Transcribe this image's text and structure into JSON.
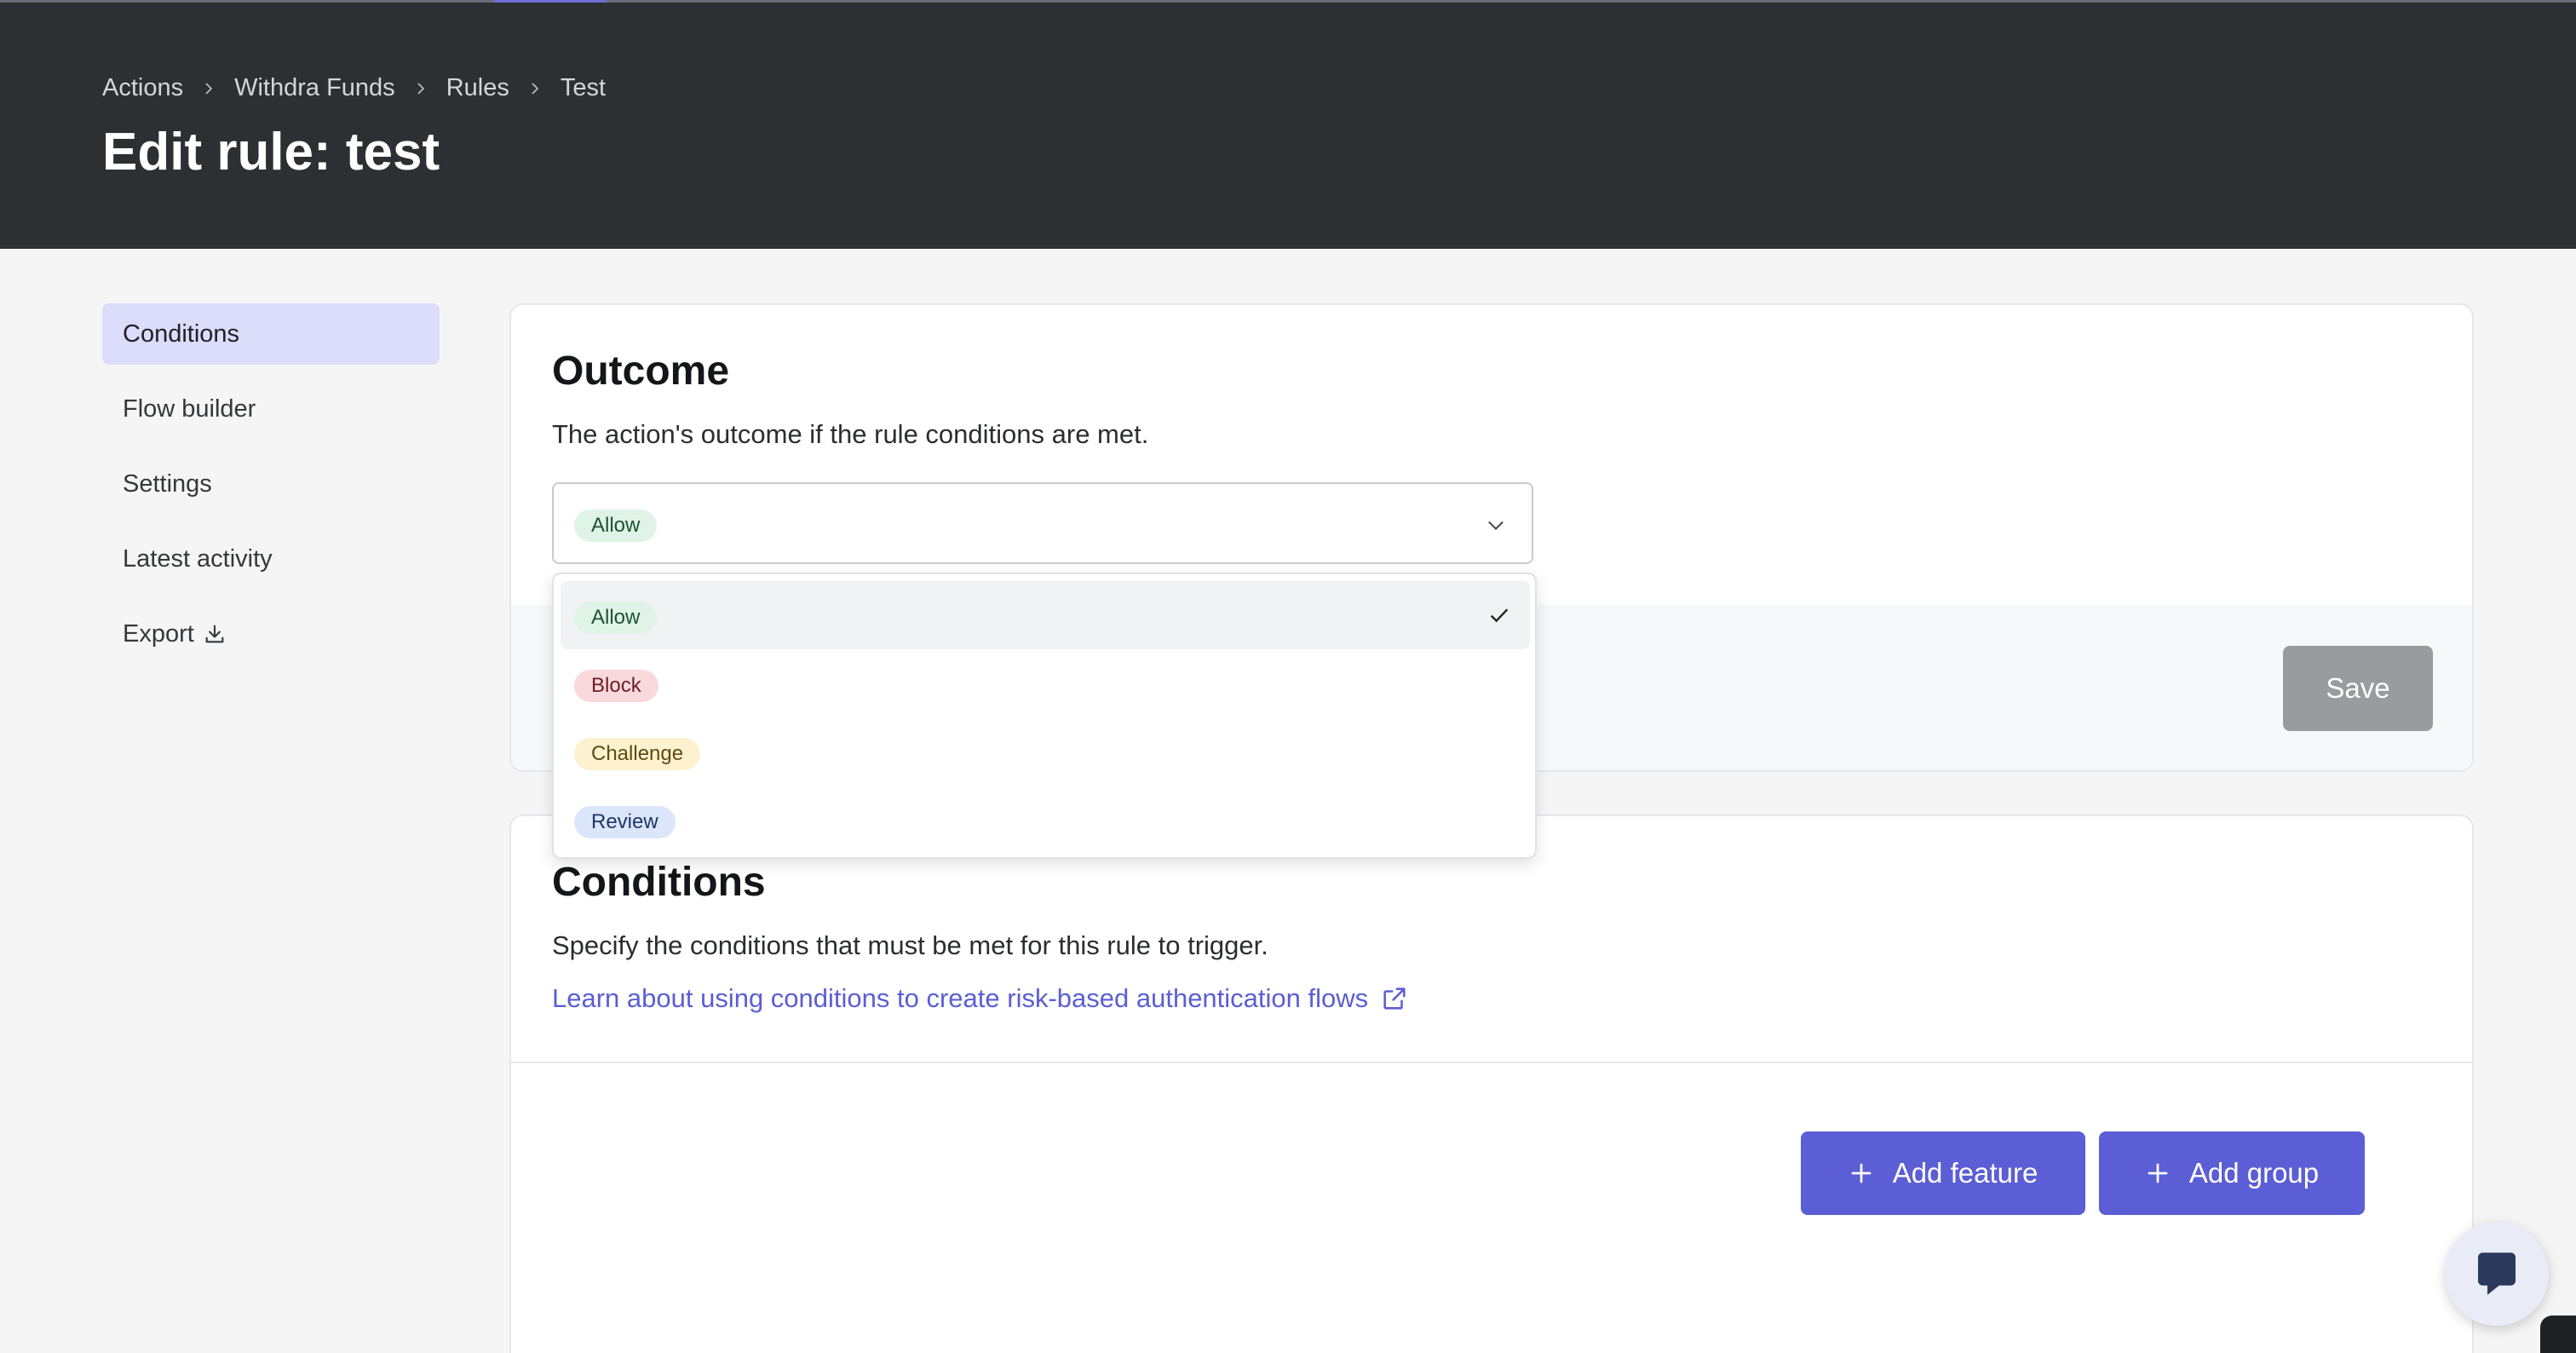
{
  "breadcrumb": [
    "Actions",
    "Withdra Funds",
    "Rules",
    "Test"
  ],
  "page_title": "Edit rule: test",
  "sidebar": {
    "items": [
      {
        "label": "Conditions",
        "active": true
      },
      {
        "label": "Flow builder"
      },
      {
        "label": "Settings"
      },
      {
        "label": "Latest activity"
      },
      {
        "label": "Export",
        "icon": "download-icon"
      }
    ]
  },
  "outcome": {
    "title": "Outcome",
    "description": "The action's outcome if the rule conditions are met.",
    "selected": "Allow",
    "options": [
      "Allow",
      "Block",
      "Challenge",
      "Review"
    ],
    "save_label": "Save"
  },
  "conditions": {
    "title": "Conditions",
    "description": "Specify the conditions that must be met for this rule to trigger.",
    "link_text": "Learn about using conditions to create risk-based authentication flows",
    "add_feature_label": "Add feature",
    "add_group_label": "Add group"
  },
  "colors": {
    "header_bg": "#2e2f33",
    "accent": "#5b5ed4",
    "active_nav": "#dcdcfb",
    "save_disabled": "#9a9b9f"
  }
}
